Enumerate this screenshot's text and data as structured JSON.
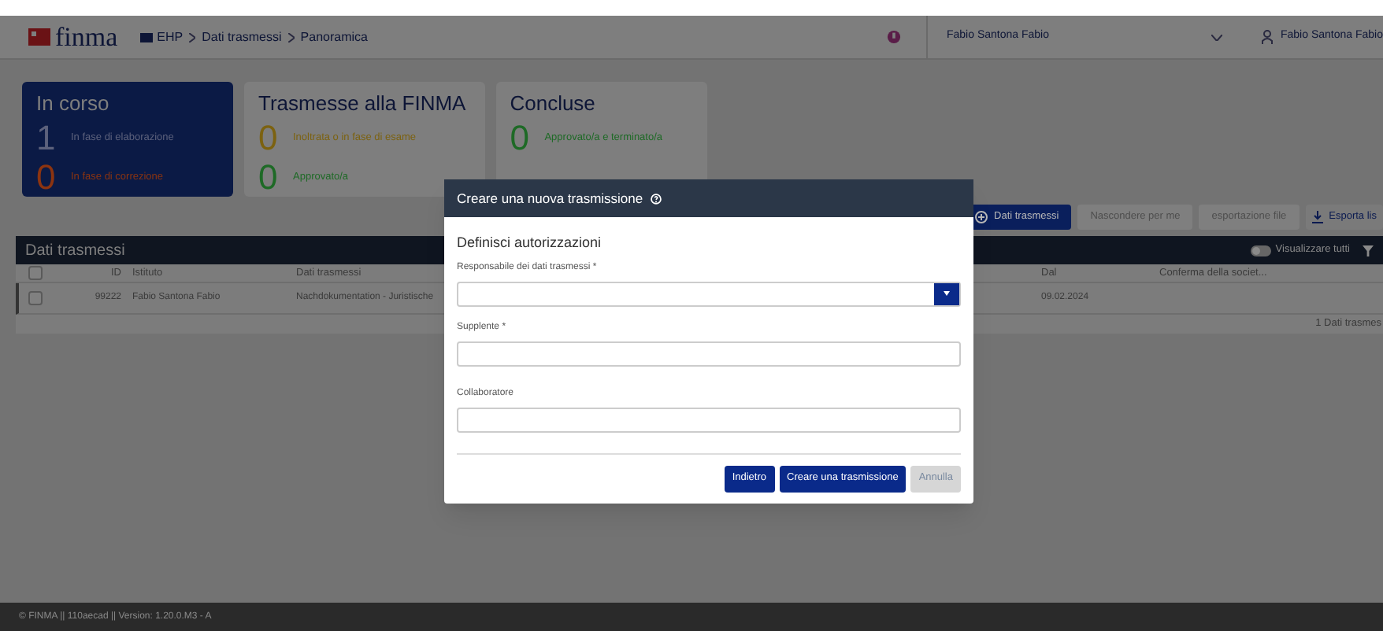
{
  "header": {
    "logo": "finma",
    "breadcrumb": [
      "EHP",
      "Dati trasmessi",
      "Panoramica"
    ],
    "user_select": "Fabio Santona Fabio",
    "user": "Fabio Santona Fabio"
  },
  "cards": [
    {
      "title": "In corso",
      "selected": true,
      "items": [
        {
          "count": "1",
          "label": "In fase di elaborazione",
          "color": "#5c617c"
        },
        {
          "count": "0",
          "label": "In fase di correzione",
          "color": "#8c3410"
        }
      ]
    },
    {
      "title": "Trasmesse alla FINMA",
      "selected": false,
      "items": [
        {
          "count": "0",
          "label": "Inoltrata o in fase di esame",
          "color": "#7c6210"
        },
        {
          "count": "0",
          "label": "Approvato/a",
          "color": "#1e6a26"
        }
      ]
    },
    {
      "title": "Concluse",
      "selected": false,
      "items": [
        {
          "count": "0",
          "label": "Approvato/a e terminato/a",
          "color": "#1e6a26"
        }
      ]
    }
  ],
  "toolbar": [
    {
      "label": "Dati trasmessi",
      "kind": "primary"
    },
    {
      "label": "Nascondere per me",
      "kind": "disabled"
    },
    {
      "label": "esportazione file",
      "kind": "disabled"
    },
    {
      "label": "Esporta lis",
      "kind": "export"
    }
  ],
  "table": {
    "title": "Dati trasmessi",
    "toggle": {
      "label": "Visualizzare tutti",
      "on": false
    },
    "select_all": {
      "checked": false
    },
    "columns": [
      "ID",
      "Istituto",
      "Dati trasmessi",
      "Dal",
      "Conferma della societ..."
    ],
    "rows": [
      {
        "checked": false,
        "cells": [
          "99222",
          "Fabio Santona Fabio",
          "Nachdokumentation - Juristische",
          "09.02.2024",
          ""
        ]
      }
    ],
    "count": "1 Dati trasmes"
  },
  "modal": {
    "title": "Creare una nuova trasmissione",
    "section": "Definisci autorizzazioni",
    "fields": [
      {
        "label": "Responsabile dei dati trasmessi *",
        "kind": "select"
      },
      {
        "label": "Supplente *",
        "kind": "text"
      },
      {
        "label": "Collaboratore",
        "kind": "text"
      }
    ],
    "buttons": [
      {
        "label": "Indietro",
        "kind": "primary"
      },
      {
        "label": "Creare una trasmissione",
        "kind": "primary"
      },
      {
        "label": "Annulla",
        "kind": "disabled"
      }
    ]
  },
  "footer": "© FINMA || 110aecad || Version: 1.20.0.M3 - A"
}
